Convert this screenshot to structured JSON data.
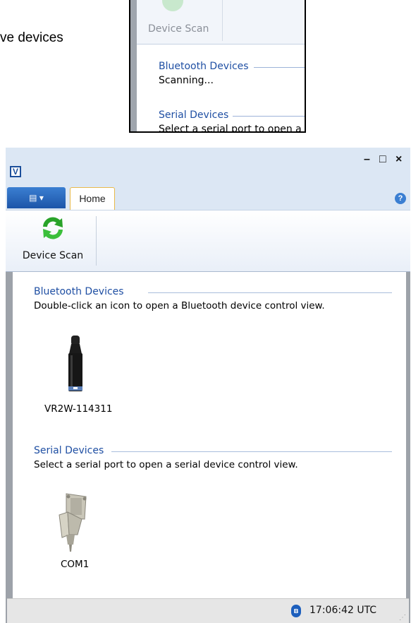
{
  "caption": {
    "text": "ve devices"
  },
  "inset": {
    "scan_button_label": "Device Scan",
    "bluetooth_title": "Bluetooth Devices",
    "bluetooth_status": "Scanning...",
    "serial_title": "Serial Devices",
    "serial_hint": "Select a serial port to open a"
  },
  "window": {
    "app_icon_letter": "V",
    "controls": {
      "minimize": "–",
      "maximize": "□",
      "close": "×"
    },
    "app_menu_label": "▤ ▾",
    "tabs": [
      {
        "label": "Home"
      }
    ],
    "help_glyph": "?",
    "ribbon": {
      "device_scan_label": "Device Scan"
    },
    "bluetooth": {
      "title": "Bluetooth Devices",
      "hint": "Double-click an icon to open a Bluetooth device control view.",
      "devices": [
        {
          "label": "VR2W-114311",
          "icon": "receiver-device-icon"
        }
      ]
    },
    "serial": {
      "title": "Serial Devices",
      "hint": "Select a serial port to open a serial device control view.",
      "ports": [
        {
          "label": "COM1",
          "icon": "serial-connector-icon"
        }
      ]
    },
    "statusbar": {
      "bluetooth_glyph": "ʙ",
      "time": "17:06:42 UTC",
      "grip": "⋰"
    }
  },
  "colors": {
    "accent": "#1f4fa3",
    "ribbon_bg": "#dce7f4",
    "scan_green": "#3bbf3b"
  }
}
